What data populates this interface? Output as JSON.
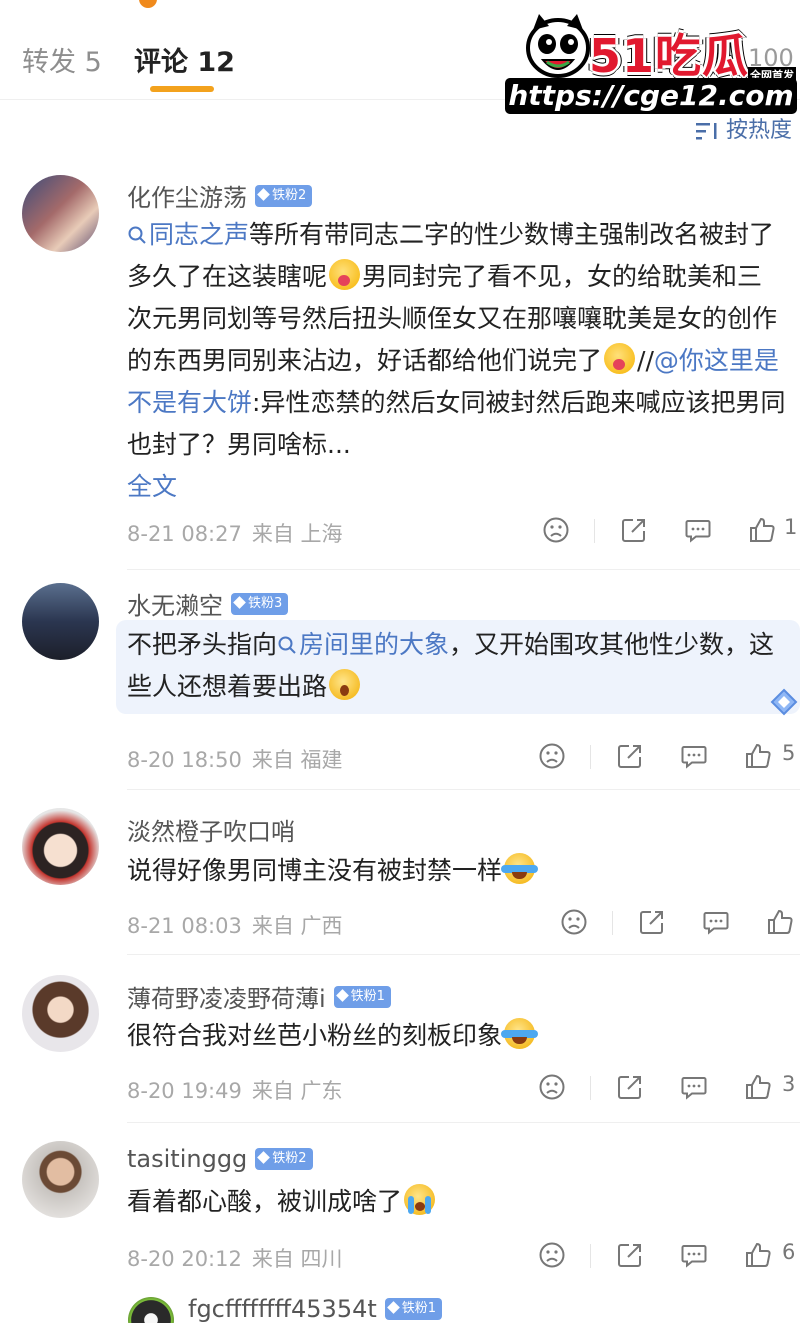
{
  "tabs": {
    "repost": "转发 5",
    "comments": "评论 12",
    "likes_count": "100"
  },
  "sort_label": "按热度",
  "watermark": {
    "brand": "51吃瓜",
    "tag": "全网首发",
    "url": "https://cge12.com"
  },
  "comments": [
    {
      "user": "化作尘游荡",
      "badge": "铁粉2",
      "link1": "同志之声",
      "text1": "等所有带同志二字的性少数博主强制改名被封了多久了在这装瞎呢",
      "text2": "男同封完了看不见，女的给耽美和三次元男同划等号然后扭头顺侄女又在那嚷嚷耽美是女的创作的东西男同别来沾边，好话都给他们说完了",
      "text3": "//",
      "mention": "@你这里是不是有大饼",
      "text4": ":异性恋禁的然后女同被封然后跑来喊应该把男同也封了？男同啥标...",
      "full_text": "全文",
      "date": "8-21 08:27",
      "source": "来自 上海",
      "likes": "1"
    },
    {
      "user": "水无濑空",
      "badge": "铁粉3",
      "text1": "不把矛头指向",
      "link1": "房间里的大象",
      "text2": "，又开始围攻其他性少数，这些人还想着要出路",
      "date": "8-20 18:50",
      "source": "来自 福建",
      "likes": "5"
    },
    {
      "user": "淡然橙子吹口哨",
      "text1": "说得好像男同博主没有被封禁一样",
      "date": "8-21 08:03",
      "source": "来自 广西"
    },
    {
      "user": "薄荷野凌凌野荷薄ⅰ",
      "badge": "铁粉1",
      "text1": "很符合我对丝芭小粉丝的刻板印象",
      "date": "8-20 19:49",
      "source": "来自 广东",
      "likes": "3"
    },
    {
      "user": "tasitinggg",
      "badge": "铁粉2",
      "text1": "看着都心酸，被训成啥了",
      "date": "8-20 20:12",
      "source": "来自 四川",
      "likes": "6"
    },
    {
      "user": "fgcffffffff45354t",
      "badge": "铁粉1"
    }
  ],
  "colors": {
    "accent": "#f3a21d",
    "link": "#4c78c4",
    "badge": "#6f9ee8",
    "brand_red": "#e1192f"
  }
}
